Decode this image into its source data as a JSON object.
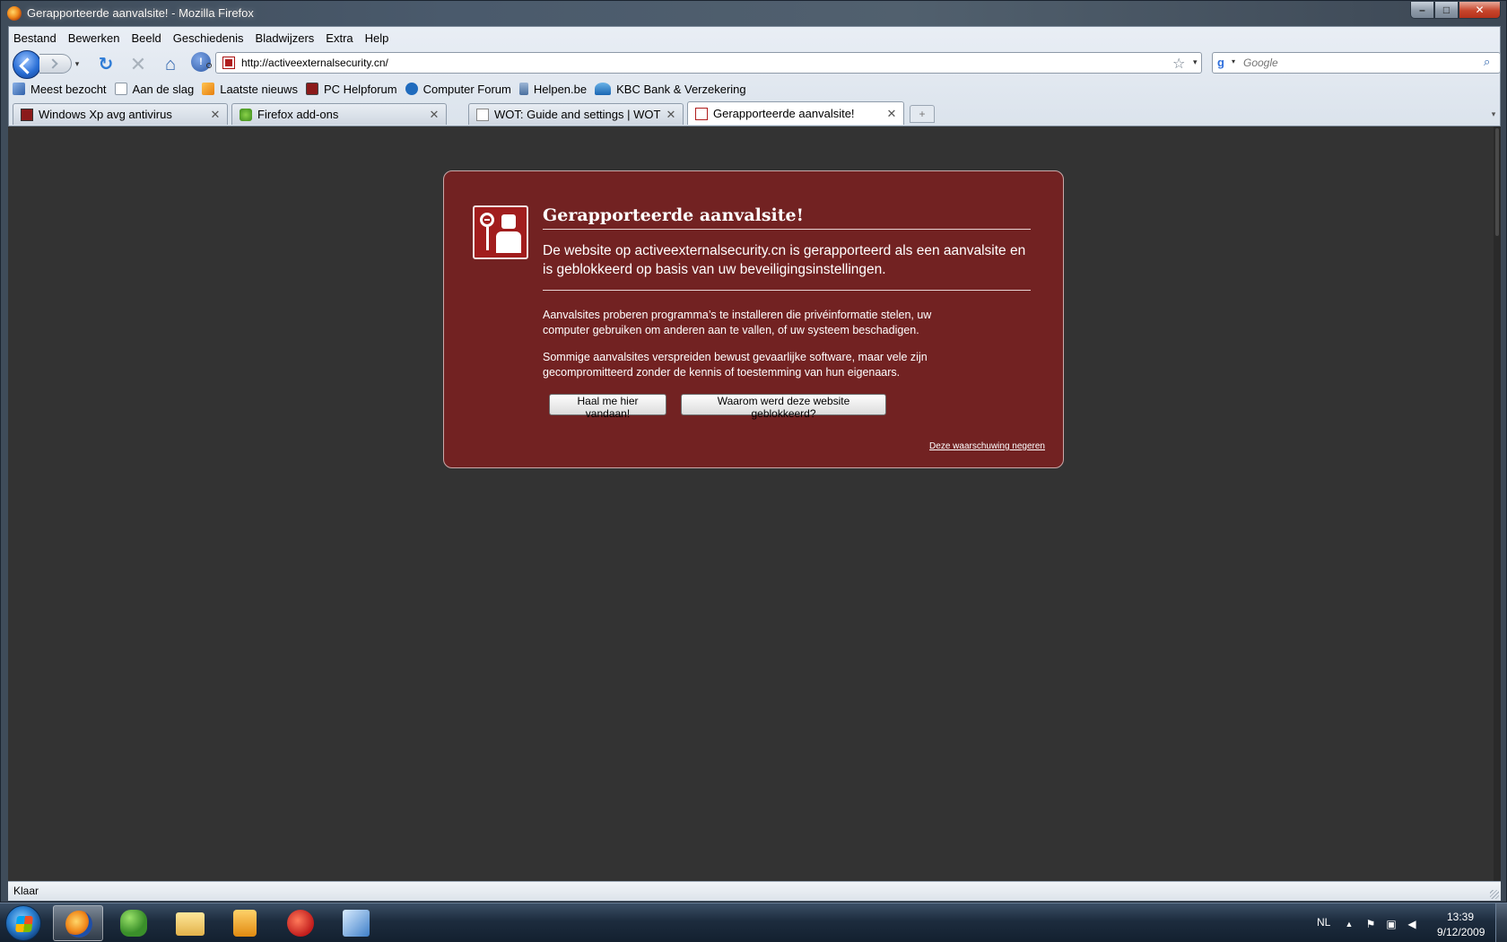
{
  "window": {
    "title": "Gerapporteerde aanvalsite! - Mozilla Firefox",
    "min_glyph": "–",
    "max_glyph": "□",
    "close_glyph": "✕"
  },
  "menu": {
    "items": [
      "Bestand",
      "Bewerken",
      "Beeld",
      "Geschiedenis",
      "Bladwijzers",
      "Extra",
      "Help"
    ]
  },
  "navbar": {
    "url": "http://activeexternalsecurity.cn/",
    "search_placeholder": "Google",
    "icons": [
      "back-icon",
      "forward-icon",
      "reload-icon",
      "stop-icon",
      "home-icon",
      "wot-icon",
      "star-icon",
      "search-icon"
    ],
    "reload_glyph": "↻",
    "stop_glyph": "✕",
    "home_glyph": "⌂",
    "wot_glyph": "!",
    "star_glyph": "☆",
    "drop_glyph": "▾",
    "engine_glyph": "g",
    "search_glyph": "⌕"
  },
  "bookmarks": [
    "Meest bezocht",
    "Aan de slag",
    "Laatste nieuws",
    "PC Helpforum",
    "Computer Forum",
    "Helpen.be",
    "KBC Bank & Verzekering"
  ],
  "tabs": [
    {
      "label": "Windows Xp avg antivirus",
      "icon": "avg-icon",
      "active": false
    },
    {
      "label": "Firefox add-ons",
      "icon": "addons-icon",
      "active": false
    },
    {
      "label": "WOT: Guide and settings | WOT We...",
      "icon": "page-icon",
      "active": false
    },
    {
      "label": "Gerapporteerde aanvalsite!",
      "icon": "attack-icon",
      "active": true
    }
  ],
  "tab_close_glyph": "✕",
  "new_tab_glyph": "+",
  "tab_list_glyph": "▾",
  "error_page": {
    "title": "Gerapporteerde aanvalsite!",
    "short_desc": "De website op activeexternalsecurity.cn is gerapporteerd als een aanvalsite en is geblokkeerd op basis van uw beveiligingsinstellingen.",
    "long_desc_1": "Aanvalsites proberen programma’s te installeren die privéinformatie stelen, uw computer gebruiken om anderen aan te vallen, of uw systeem beschadigen.",
    "long_desc_2": "Sommige aanvalsites verspreiden bewust gevaarlijke software, maar vele zijn gecompromitteerd zonder de kennis of toestemming van hun eigenaars.",
    "button_getout": "Haal me hier vandaan!",
    "button_why": "Waarom werd deze website geblokkeerd?",
    "ignore_link": "Deze waarschuwing negeren",
    "accent_color": "#722222"
  },
  "status": {
    "text": "Klaar"
  },
  "taskbar": {
    "lang": "NL",
    "time": "13:39",
    "date": "9/12/2009",
    "apps": [
      "firefox-icon",
      "messenger-icon",
      "explorer-icon",
      "media-player-icon",
      "ccleaner-icon",
      "app-icon"
    ],
    "tray_arrow_glyph": "▲",
    "tray_flag_glyph": "⚑",
    "tray_network_glyph": "▣",
    "tray_volume_glyph": "◀"
  }
}
